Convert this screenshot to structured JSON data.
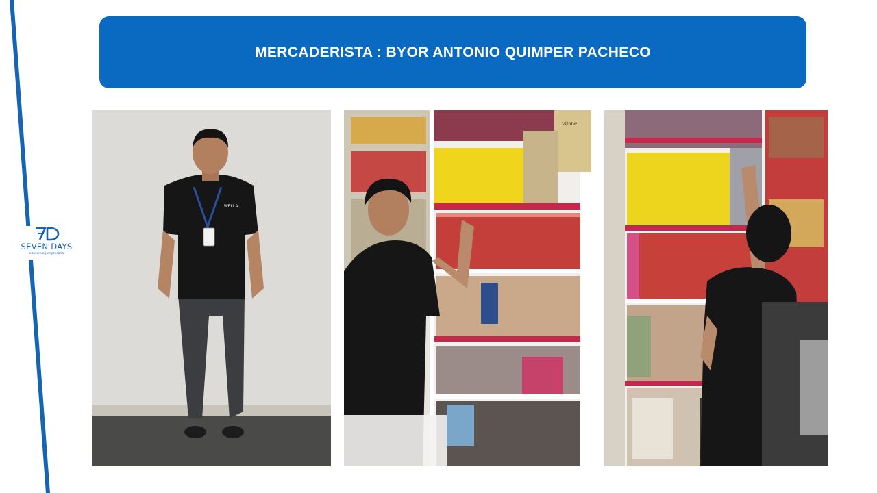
{
  "header": {
    "title": "MERCADERISTA : BYOR ANTONIO QUIMPER PACHECO"
  },
  "logo": {
    "mark": "7D",
    "name": "SEVEN DAYS",
    "tagline": "outsourcing empresarial"
  },
  "photos": [
    {
      "name": "portrait-photo",
      "badge_text": "WELLA"
    },
    {
      "name": "shelf-photo-1",
      "box_text": "vitane"
    },
    {
      "name": "shelf-photo-2"
    }
  ],
  "colors": {
    "brand_blue": "#0a6ac2",
    "stripe_blue": "#1565b4",
    "white": "#ffffff"
  }
}
